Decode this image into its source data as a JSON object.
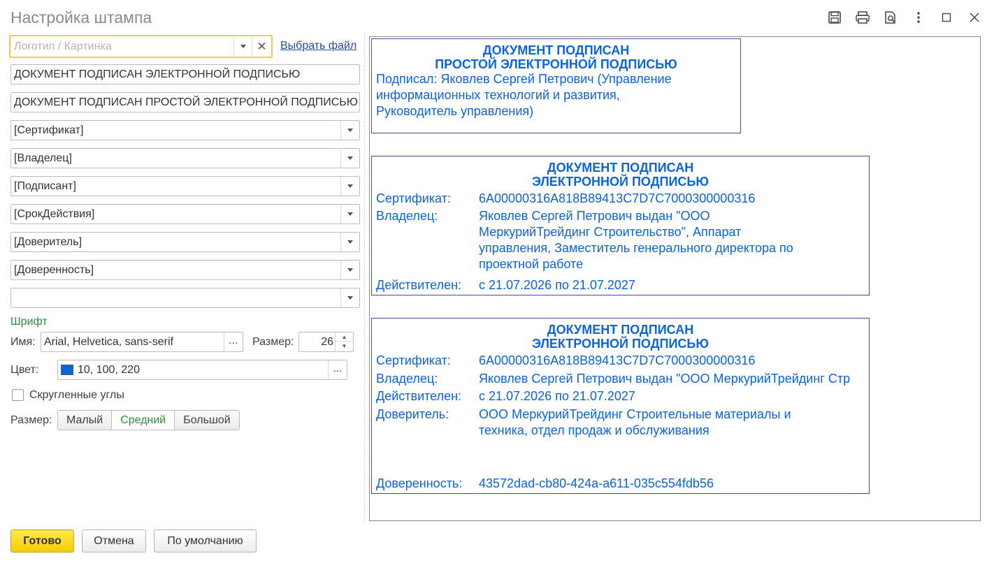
{
  "window": {
    "title": "Настройка штампа",
    "icons": [
      "save-icon",
      "print-icon",
      "preview-icon",
      "more-icon",
      "maximize-icon",
      "close-icon"
    ]
  },
  "form": {
    "logo_placeholder": "Логотип / Картинка",
    "choose_file": "Выбрать файл",
    "line1": "ДОКУМЕНТ ПОДПИСАН ЭЛЕКТРОННОЙ ПОДПИСЬЮ",
    "line2": "ДОКУМЕНТ ПОДПИСАН ПРОСТОЙ ЭЛЕКТРОННОЙ ПОДПИСЬЮ",
    "fields": [
      "[Сертификат]",
      "[Владелец]",
      "[Подписант]",
      "[СрокДействия]",
      "[Доверитель]",
      "[Доверенность]",
      ""
    ],
    "font_section": "Шрифт",
    "name_label": "Имя:",
    "font_name": "Arial, Helvetica, sans-serif",
    "size_label": "Размер:",
    "size_value": "26",
    "color_label": "Цвет:",
    "color_value": "10, 100, 220",
    "color_hex": "#0a64dc",
    "rounded_label": "Скругленные углы",
    "rounded_checked": false,
    "stamp_size_label": "Размер:",
    "sizes": [
      "Малый",
      "Средний",
      "Большой"
    ],
    "size_selected": "Средний",
    "ellipsis": "..."
  },
  "preview": {
    "stamp1": {
      "head1": "ДОКУМЕНТ ПОДПИСАН",
      "head2": "ПРОСТОЙ ЭЛЕКТРОННОЙ ПОДПИСЬЮ",
      "line1": "Подписал: Яковлев Сергей Петрович (Управление",
      "line2": "информационных технологий и развития,",
      "line3": "Руководитель управления)"
    },
    "stamp2": {
      "head1": "ДОКУМЕНТ ПОДПИСАН",
      "head2": "ЭЛЕКТРОННОЙ ПОДПИСЬЮ",
      "cert_label": "Сертификат:",
      "cert_value": "6A00000316A818B89413C7D7C7000300000316",
      "owner_label": "Владелец:",
      "owner_value": "Яковлев Сергей Петрович выдан \"ООО\nМеркурийТрейдинг Строительство\", Аппарат\nуправления, Заместитель генерального директора по\nпроектной работе",
      "valid_label": "Действителен:",
      "valid_value": "с 21.07.2026 по 21.07.2027"
    },
    "stamp3": {
      "head1": "ДОКУМЕНТ ПОДПИСАН",
      "head2": "ЭЛЕКТРОННОЙ ПОДПИСЬЮ",
      "cert_label": "Сертификат:",
      "cert_value": "6A00000316A818B89413C7D7C7000300000316",
      "owner_label": "Владелец:",
      "owner_value": "Яковлев Сергей Петрович выдан \"ООО МеркурийТрейдинг Стр",
      "valid_label": "Действителен:",
      "valid_value": "с 21.07.2026 по 21.07.2027",
      "principal_label": "Доверитель:",
      "principal_value": "ООО МеркурийТрейдинг Строительные материалы и\nтехника, отдел продаж и обслуживания",
      "poa_label": "Доверенность:",
      "poa_value": "43572dad-cb80-424a-a611-035c554fdb56"
    }
  },
  "buttons": {
    "done": "Готово",
    "cancel": "Отмена",
    "default": "По умолчанию"
  }
}
